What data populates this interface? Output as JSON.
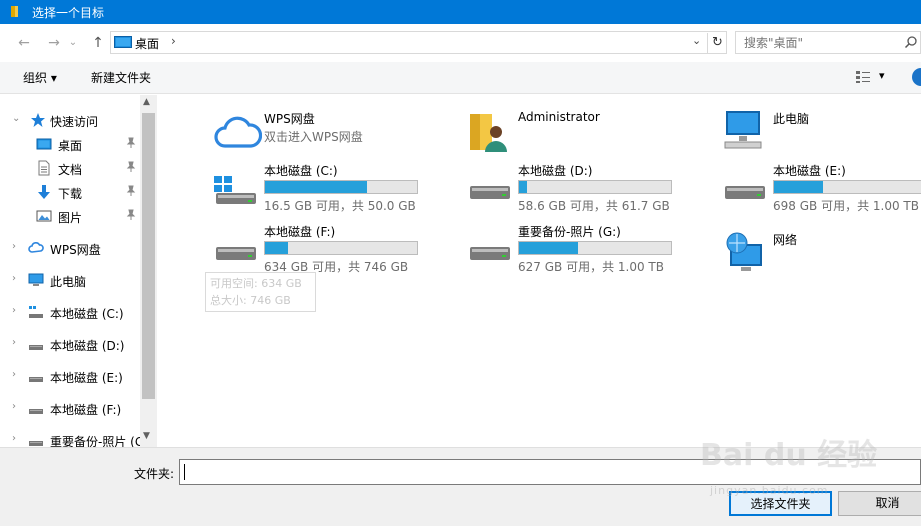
{
  "window": {
    "title": "选择一个目标"
  },
  "address": {
    "crumb": "桌面",
    "chevron": "›",
    "dropdown": "⌄",
    "refresh": "↻",
    "search_placeholder": "搜索\"桌面\""
  },
  "nav": {
    "back": "←",
    "forward": "→",
    "recent": "⌄",
    "up": "↑"
  },
  "toolbar": {
    "organize": "组织 ▾",
    "new_folder": "新建文件夹",
    "view_dropdown": "▾"
  },
  "sidebar": {
    "quick_access": "快速访问",
    "desktop": "桌面",
    "documents": "文档",
    "downloads": "下载",
    "pictures": "图片",
    "wps": "WPS网盘",
    "this_pc": "此电脑",
    "disk_c": "本地磁盘 (C:)",
    "disk_d": "本地磁盘 (D:)",
    "disk_e": "本地磁盘 (E:)",
    "disk_f": "本地磁盘 (F:)",
    "disk_g": "重要备份-照片 (G:"
  },
  "items": {
    "wps": {
      "name": "WPS网盘",
      "sub": "双击进入WPS网盘"
    },
    "admin": {
      "name": "Administrator"
    },
    "pc": {
      "name": "此电脑"
    },
    "c": {
      "name": "本地磁盘 (C:)",
      "info": "16.5 GB 可用，共 50.0 GB",
      "used_fraction": 0.67
    },
    "d": {
      "name": "本地磁盘 (D:)",
      "info": "58.6 GB 可用，共 61.7 GB",
      "used_fraction": 0.05
    },
    "e": {
      "name": "本地磁盘 (E:)",
      "info": "698 GB 可用，共 1.00 TB",
      "used_fraction": 0.32
    },
    "f": {
      "name": "本地磁盘 (F:)",
      "info": "634 GB 可用，共 746 GB",
      "used_fraction": 0.15
    },
    "g": {
      "name": "重要备份-照片 (G:)",
      "info": "627 GB 可用，共 1.00 TB",
      "used_fraction": 0.39
    },
    "net": {
      "name": "网络"
    }
  },
  "tooltip": {
    "line1": "可用空间: 634 GB",
    "line2": "总大小: 746 GB"
  },
  "bottom": {
    "folder_label": "文件夹:",
    "folder_value": "",
    "select_button": "选择文件夹",
    "cancel_button": "取消"
  },
  "watermark": {
    "brand": "Bai du 经验",
    "url": "jingyan.baidu.com"
  },
  "colors": {
    "titlebar": "#0078d7",
    "bar_fill": "#26a0da",
    "accent": "#0078d7"
  }
}
